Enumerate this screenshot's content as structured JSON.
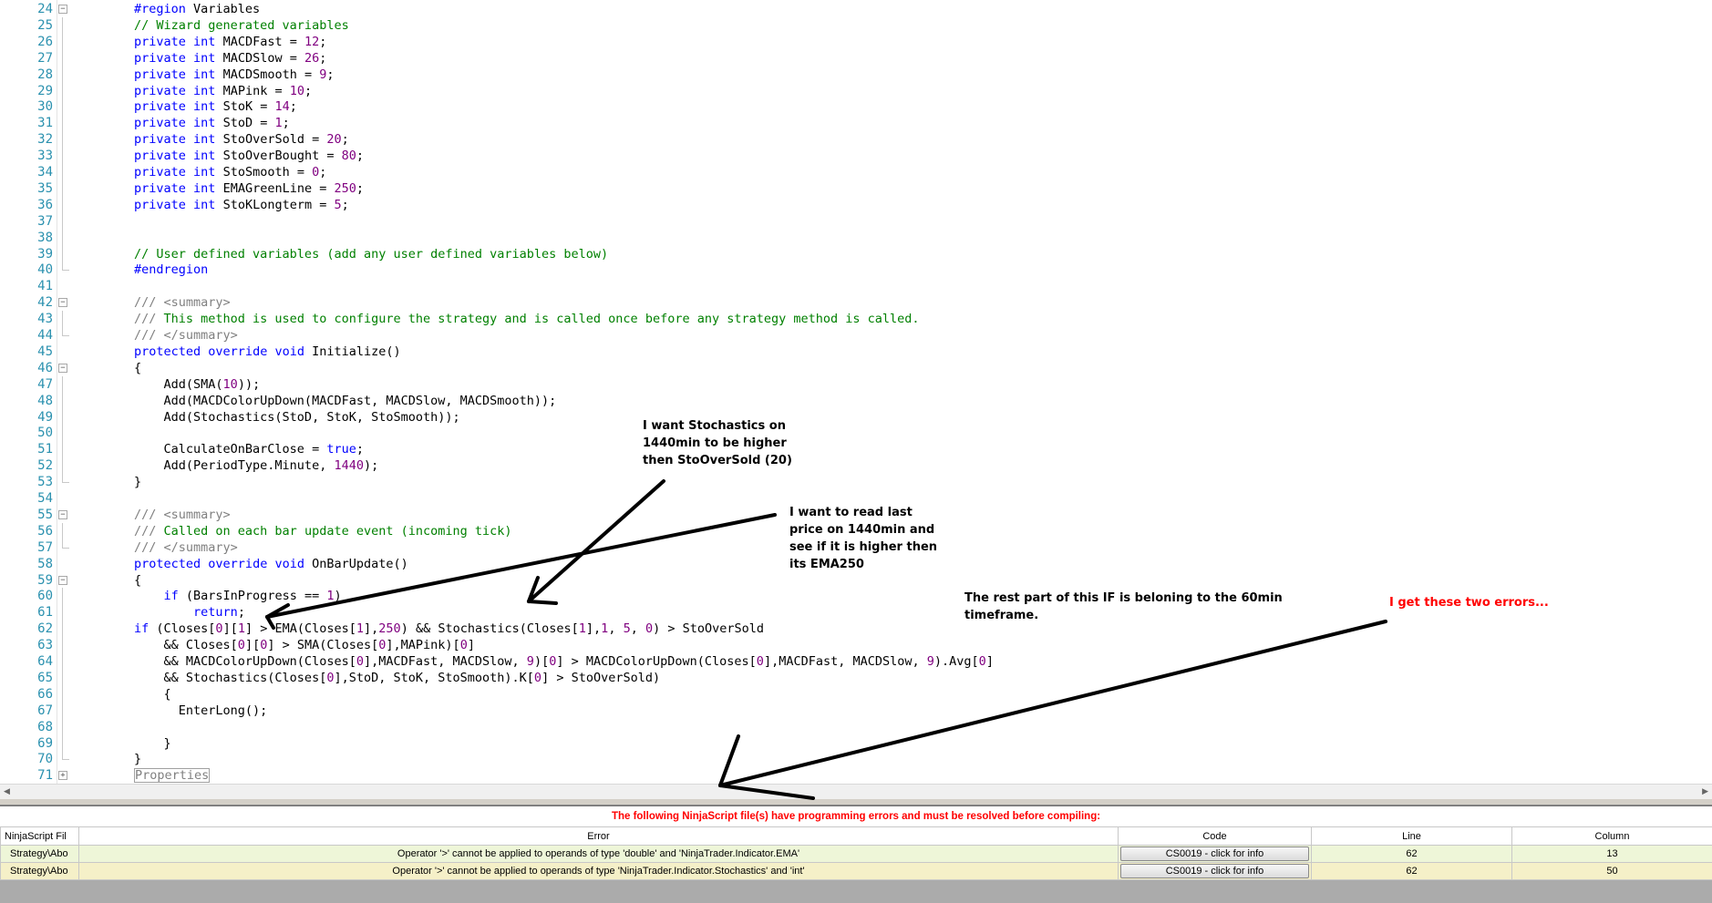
{
  "editor": {
    "lines": [
      {
        "n": "24",
        "fold": "minus",
        "segs": [
          {
            "t": "#region",
            "c": "kw"
          },
          {
            "t": " Variables"
          }
        ]
      },
      {
        "n": "25",
        "fold": "line",
        "segs": [
          {
            "t": "// Wizard generated variables",
            "c": "cm"
          }
        ]
      },
      {
        "n": "26",
        "fold": "line",
        "segs": [
          {
            "t": "private",
            "c": "kw"
          },
          {
            "t": " "
          },
          {
            "t": "int",
            "c": "kw"
          },
          {
            "t": " MACDFast = "
          },
          {
            "t": "12",
            "c": "num"
          },
          {
            "t": ";"
          }
        ]
      },
      {
        "n": "27",
        "fold": "line",
        "segs": [
          {
            "t": "private",
            "c": "kw"
          },
          {
            "t": " "
          },
          {
            "t": "int",
            "c": "kw"
          },
          {
            "t": " MACDSlow = "
          },
          {
            "t": "26",
            "c": "num"
          },
          {
            "t": ";"
          }
        ]
      },
      {
        "n": "28",
        "fold": "line",
        "segs": [
          {
            "t": "private",
            "c": "kw"
          },
          {
            "t": " "
          },
          {
            "t": "int",
            "c": "kw"
          },
          {
            "t": " MACDSmooth = "
          },
          {
            "t": "9",
            "c": "num"
          },
          {
            "t": ";"
          }
        ]
      },
      {
        "n": "29",
        "fold": "line",
        "segs": [
          {
            "t": "private",
            "c": "kw"
          },
          {
            "t": " "
          },
          {
            "t": "int",
            "c": "kw"
          },
          {
            "t": " MAPink = "
          },
          {
            "t": "10",
            "c": "num"
          },
          {
            "t": ";"
          }
        ]
      },
      {
        "n": "30",
        "fold": "line",
        "segs": [
          {
            "t": "private",
            "c": "kw"
          },
          {
            "t": " "
          },
          {
            "t": "int",
            "c": "kw"
          },
          {
            "t": " StoK = "
          },
          {
            "t": "14",
            "c": "num"
          },
          {
            "t": ";"
          }
        ]
      },
      {
        "n": "31",
        "fold": "line",
        "segs": [
          {
            "t": "private",
            "c": "kw"
          },
          {
            "t": " "
          },
          {
            "t": "int",
            "c": "kw"
          },
          {
            "t": " StoD = "
          },
          {
            "t": "1",
            "c": "num"
          },
          {
            "t": ";"
          }
        ]
      },
      {
        "n": "32",
        "fold": "line",
        "segs": [
          {
            "t": "private",
            "c": "kw"
          },
          {
            "t": " "
          },
          {
            "t": "int",
            "c": "kw"
          },
          {
            "t": " StoOverSold = "
          },
          {
            "t": "20",
            "c": "num"
          },
          {
            "t": ";"
          }
        ]
      },
      {
        "n": "33",
        "fold": "line",
        "segs": [
          {
            "t": "private",
            "c": "kw"
          },
          {
            "t": " "
          },
          {
            "t": "int",
            "c": "kw"
          },
          {
            "t": " StoOverBought = "
          },
          {
            "t": "80",
            "c": "num"
          },
          {
            "t": ";"
          }
        ]
      },
      {
        "n": "34",
        "fold": "line",
        "segs": [
          {
            "t": "private",
            "c": "kw"
          },
          {
            "t": " "
          },
          {
            "t": "int",
            "c": "kw"
          },
          {
            "t": " StoSmooth = "
          },
          {
            "t": "0",
            "c": "num"
          },
          {
            "t": ";"
          }
        ]
      },
      {
        "n": "35",
        "fold": "line",
        "segs": [
          {
            "t": "private",
            "c": "kw"
          },
          {
            "t": " "
          },
          {
            "t": "int",
            "c": "kw"
          },
          {
            "t": " EMAGreenLine = "
          },
          {
            "t": "250",
            "c": "num"
          },
          {
            "t": ";"
          }
        ]
      },
      {
        "n": "36",
        "fold": "line",
        "segs": [
          {
            "t": "private",
            "c": "kw"
          },
          {
            "t": " "
          },
          {
            "t": "int",
            "c": "kw"
          },
          {
            "t": " StoKLongterm = "
          },
          {
            "t": "5",
            "c": "num"
          },
          {
            "t": ";"
          }
        ]
      },
      {
        "n": "37",
        "fold": "line",
        "segs": []
      },
      {
        "n": "38",
        "fold": "line",
        "segs": []
      },
      {
        "n": "39",
        "fold": "line",
        "segs": [
          {
            "t": "// User defined variables (add any user defined variables below)",
            "c": "cm"
          }
        ]
      },
      {
        "n": "40",
        "fold": "end",
        "segs": [
          {
            "t": "#endregion",
            "c": "kw"
          }
        ]
      },
      {
        "n": "41",
        "fold": "",
        "segs": []
      },
      {
        "n": "42",
        "fold": "minus",
        "segs": [
          {
            "t": "/// <summary>",
            "c": "xd"
          }
        ]
      },
      {
        "n": "43",
        "fold": "line",
        "segs": [
          {
            "t": "/// ",
            "c": "xd"
          },
          {
            "t": "This method is used to configure the strategy and is called once before any strategy method is called.",
            "c": "cm"
          }
        ]
      },
      {
        "n": "44",
        "fold": "end",
        "segs": [
          {
            "t": "/// </summary>",
            "c": "xd"
          }
        ]
      },
      {
        "n": "45",
        "fold": "",
        "segs": [
          {
            "t": "protected",
            "c": "kw"
          },
          {
            "t": " "
          },
          {
            "t": "override",
            "c": "kw"
          },
          {
            "t": " "
          },
          {
            "t": "void",
            "c": "kw"
          },
          {
            "t": " Initialize()"
          }
        ]
      },
      {
        "n": "46",
        "fold": "minus",
        "segs": [
          {
            "t": "{"
          }
        ]
      },
      {
        "n": "47",
        "fold": "line",
        "segs": [
          {
            "t": "    Add(SMA("
          },
          {
            "t": "10",
            "c": "num"
          },
          {
            "t": "));"
          }
        ]
      },
      {
        "n": "48",
        "fold": "line",
        "segs": [
          {
            "t": "    Add(MACDColorUpDown(MACDFast, MACDSlow, MACDSmooth));"
          }
        ]
      },
      {
        "n": "49",
        "fold": "line",
        "segs": [
          {
            "t": "    Add(Stochastics(StoD, StoK, StoSmooth));"
          }
        ]
      },
      {
        "n": "50",
        "fold": "line",
        "segs": []
      },
      {
        "n": "51",
        "fold": "line",
        "segs": [
          {
            "t": "    CalculateOnBarClose = "
          },
          {
            "t": "true",
            "c": "kw"
          },
          {
            "t": ";"
          }
        ]
      },
      {
        "n": "52",
        "fold": "line",
        "segs": [
          {
            "t": "    Add(PeriodType.Minute, "
          },
          {
            "t": "1440",
            "c": "num"
          },
          {
            "t": ");"
          }
        ]
      },
      {
        "n": "53",
        "fold": "end",
        "segs": [
          {
            "t": "}"
          }
        ]
      },
      {
        "n": "54",
        "fold": "",
        "segs": []
      },
      {
        "n": "55",
        "fold": "minus",
        "segs": [
          {
            "t": "/// <summary>",
            "c": "xd"
          }
        ]
      },
      {
        "n": "56",
        "fold": "line",
        "segs": [
          {
            "t": "/// ",
            "c": "xd"
          },
          {
            "t": "Called on each bar update event (incoming tick)",
            "c": "cm"
          }
        ]
      },
      {
        "n": "57",
        "fold": "end",
        "segs": [
          {
            "t": "/// </summary>",
            "c": "xd"
          }
        ]
      },
      {
        "n": "58",
        "fold": "",
        "segs": [
          {
            "t": "protected",
            "c": "kw"
          },
          {
            "t": " "
          },
          {
            "t": "override",
            "c": "kw"
          },
          {
            "t": " "
          },
          {
            "t": "void",
            "c": "kw"
          },
          {
            "t": " OnBarUpdate()"
          }
        ]
      },
      {
        "n": "59",
        "fold": "minus",
        "segs": [
          {
            "t": "{"
          }
        ]
      },
      {
        "n": "60",
        "fold": "line",
        "segs": [
          {
            "t": "    "
          },
          {
            "t": "if",
            "c": "kw"
          },
          {
            "t": " (BarsInProgress == "
          },
          {
            "t": "1",
            "c": "num"
          },
          {
            "t": ")"
          }
        ]
      },
      {
        "n": "61",
        "fold": "line",
        "segs": [
          {
            "t": "        "
          },
          {
            "t": "return",
            "c": "kw"
          },
          {
            "t": ";"
          }
        ]
      },
      {
        "n": "62",
        "fold": "line",
        "segs": [
          {
            "t": "if",
            "c": "kw"
          },
          {
            "t": " (Closes["
          },
          {
            "t": "0",
            "c": "num"
          },
          {
            "t": "]["
          },
          {
            "t": "1",
            "c": "num"
          },
          {
            "t": "] > EMA(Closes["
          },
          {
            "t": "1",
            "c": "num"
          },
          {
            "t": "],"
          },
          {
            "t": "250",
            "c": "num"
          },
          {
            "t": ") && Stochastics(Closes["
          },
          {
            "t": "1",
            "c": "num"
          },
          {
            "t": "],"
          },
          {
            "t": "1",
            "c": "num"
          },
          {
            "t": ", "
          },
          {
            "t": "5",
            "c": "num"
          },
          {
            "t": ", "
          },
          {
            "t": "0",
            "c": "num"
          },
          {
            "t": ") > StoOverSold"
          }
        ]
      },
      {
        "n": "63",
        "fold": "line",
        "segs": [
          {
            "t": "    && Closes["
          },
          {
            "t": "0",
            "c": "num"
          },
          {
            "t": "]["
          },
          {
            "t": "0",
            "c": "num"
          },
          {
            "t": "] > SMA(Closes["
          },
          {
            "t": "0",
            "c": "num"
          },
          {
            "t": "],MAPink)["
          },
          {
            "t": "0",
            "c": "num"
          },
          {
            "t": "]"
          }
        ]
      },
      {
        "n": "64",
        "fold": "line",
        "segs": [
          {
            "t": "    && MACDColorUpDown(Closes["
          },
          {
            "t": "0",
            "c": "num"
          },
          {
            "t": "],MACDFast, MACDSlow, "
          },
          {
            "t": "9",
            "c": "num"
          },
          {
            "t": ")["
          },
          {
            "t": "0",
            "c": "num"
          },
          {
            "t": "] > MACDColorUpDown(Closes["
          },
          {
            "t": "0",
            "c": "num"
          },
          {
            "t": "],MACDFast, MACDSlow, "
          },
          {
            "t": "9",
            "c": "num"
          },
          {
            "t": ").Avg["
          },
          {
            "t": "0",
            "c": "num"
          },
          {
            "t": "]"
          }
        ]
      },
      {
        "n": "65",
        "fold": "line",
        "segs": [
          {
            "t": "    && Stochastics(Closes["
          },
          {
            "t": "0",
            "c": "num"
          },
          {
            "t": "],StoD, StoK, StoSmooth).K["
          },
          {
            "t": "0",
            "c": "num"
          },
          {
            "t": "] > StoOverSold)"
          }
        ]
      },
      {
        "n": "66",
        "fold": "line",
        "segs": [
          {
            "t": "    {"
          }
        ]
      },
      {
        "n": "67",
        "fold": "line",
        "segs": [
          {
            "t": "      EnterLong();"
          }
        ]
      },
      {
        "n": "68",
        "fold": "line",
        "segs": []
      },
      {
        "n": "69",
        "fold": "line",
        "segs": [
          {
            "t": "    }"
          }
        ]
      },
      {
        "n": "70",
        "fold": "end",
        "segs": [
          {
            "t": "}"
          }
        ]
      },
      {
        "n": "71",
        "fold": "plus",
        "segs": [
          {
            "t": "Properties",
            "c": "xd"
          }
        ]
      }
    ]
  },
  "annotations": {
    "stochastics_note": [
      "I want Stochastics on",
      "1440min to be higher",
      "then StoOverSold (20)"
    ],
    "price_note": [
      "I want to read last",
      "price on 1440min and",
      "see if it is higher then",
      "its EMA250"
    ],
    "timeframe_note": [
      "The rest part of this IF is beloning to the 60min",
      "timeframe."
    ],
    "errors_note": "I get these two errors..."
  },
  "error_panel": {
    "header": "The following NinjaScript file(s) have programming errors and must be resolved before compiling:",
    "columns": [
      "NinjaScript Fil",
      "Error",
      "Code",
      "Line",
      "Column"
    ],
    "rows": [
      {
        "file": "Strategy\\Abo",
        "error": "Operator '>' cannot be applied to operands of type 'double' and 'NinjaTrader.Indicator.EMA'",
        "code": "CS0019 - click for info",
        "line": "62",
        "column": "13"
      },
      {
        "file": "Strategy\\Abo",
        "error": "Operator '>' cannot be applied to operands of type 'NinjaTrader.Indicator.Stochastics' and 'int'",
        "code": "CS0019 - click for info",
        "line": "62",
        "column": "50"
      }
    ]
  },
  "colors": {
    "keyword": "#0000ff",
    "comment": "#008000",
    "xmldoc": "#808080",
    "number": "#800080",
    "line_number": "#2b91af",
    "error_header": "#ff0000",
    "errors_note": "#ff0000",
    "row1_bg": "#eef6d8",
    "row2_bg": "#f5f0c8"
  }
}
